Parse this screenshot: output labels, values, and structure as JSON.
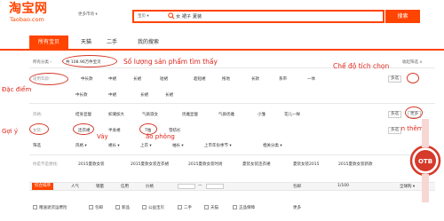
{
  "header": {
    "logo_main": "淘宝网",
    "logo_sub": "Taobao.com",
    "more_markets": "更多市场 ▾",
    "search_type": "宝贝 ▾",
    "search_query": "女 裙子 夏装",
    "search_button": "搜索"
  },
  "tabs": [
    "所有宝贝",
    "天猫",
    "二手",
    "我的搜索"
  ],
  "results": {
    "crumb_all": "所有分类 ›",
    "crumb_query": "共 108.96万件宝贝",
    "collapse_filter": "收起筛选 ∧"
  },
  "annotations": {
    "count_found": "Số lượng sản phẩm tìm thấy",
    "multi_select_mode": "Chế độ tích chọn",
    "features": "Đặc điểm",
    "suggestions": "Gợi ý",
    "skirt": "Váy",
    "tshirt": "áo phông",
    "see_more": "xem thêm"
  },
  "filters": {
    "row1_label": "适用年龄:",
    "row1_items": [
      "中长款",
      "中裙",
      "长裙",
      "短裙",
      "超短裙",
      "拖地",
      "长款",
      "系带",
      "一体"
    ],
    "row1_multi": "多选",
    "row2_items": [
      "中长款",
      "中裙",
      "长裙",
      "长裙"
    ],
    "row3_label": "风格:",
    "row3_items": [
      "结身显瘦",
      "如潮加大",
      "气质淑女",
      "优雅显瘦",
      "气质优雅",
      "小雏",
      "花儿一样"
    ],
    "row3_multi": "多选",
    "row3_more": "更多",
    "row4_label": "女装:",
    "row4_items": [
      "连衣裙",
      "半身裙",
      "T恤",
      "雪纺衫"
    ],
    "row4_multi": "多选",
    "row4_more": "更多 ▾",
    "row5_items": [
      "筛选",
      "风格 ▾",
      "裙长 ▾",
      "上衣 ▾",
      "袖长 ▾",
      "上市年份季节 ▾",
      "相关分类 ▾"
    ],
    "row6_label": "你是不是想找:",
    "row6_items": [
      "2015夏款女装",
      "2015夏款女装连衣裙",
      "2015夏款女装时尚",
      "夏装女装连衣裙",
      "夏装女装2015",
      "2015夏款女装新款"
    ]
  },
  "sort": {
    "items": [
      "综合排序",
      "人气",
      "销量",
      "信用",
      "价格"
    ],
    "price_sep": "—",
    "shipping": "包邮",
    "pages": "1/100",
    "right": "全球购 ▾"
  },
  "checks": [
    "赠送退货运费险",
    "包邮",
    "新品",
    "公益宝贝",
    "二手",
    "天猫",
    "正品保障",
    "更多"
  ]
}
